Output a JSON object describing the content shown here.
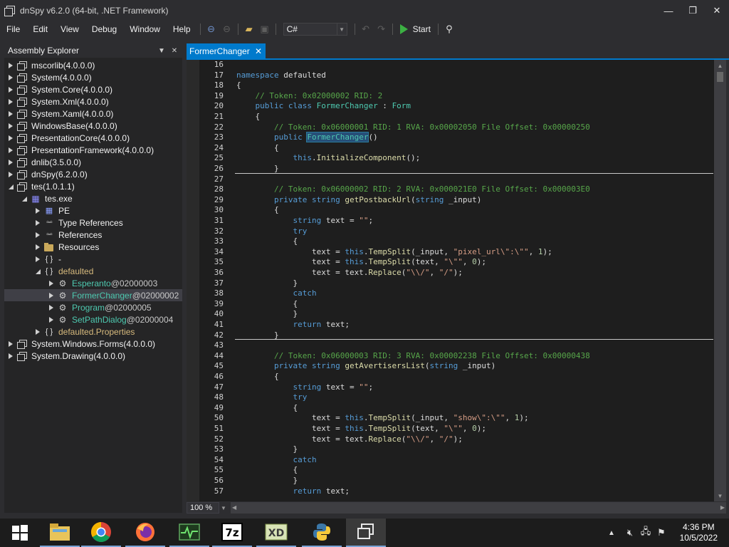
{
  "window": {
    "title": "dnSpy v6.2.0 (64-bit, .NET Framework)",
    "controls": [
      "—",
      "❐",
      "✕"
    ]
  },
  "menu": [
    "File",
    "Edit",
    "View",
    "Debug",
    "Window",
    "Help"
  ],
  "toolbar": {
    "language": "C#",
    "start_label": "Start"
  },
  "explorer": {
    "title": "Assembly Explorer",
    "items": [
      {
        "label": "mscorlib",
        "suffix": " (4.0.0.0)",
        "icon": "assembly",
        "state": "closed",
        "level": 0,
        "color": "plain"
      },
      {
        "label": "System",
        "suffix": " (4.0.0.0)",
        "icon": "assembly",
        "state": "closed",
        "level": 0,
        "color": "plain"
      },
      {
        "label": "System.Core",
        "suffix": " (4.0.0.0)",
        "icon": "assembly",
        "state": "closed",
        "level": 0,
        "color": "plain"
      },
      {
        "label": "System.Xml",
        "suffix": " (4.0.0.0)",
        "icon": "assembly",
        "state": "closed",
        "level": 0,
        "color": "plain"
      },
      {
        "label": "System.Xaml",
        "suffix": " (4.0.0.0)",
        "icon": "assembly",
        "state": "closed",
        "level": 0,
        "color": "plain"
      },
      {
        "label": "WindowsBase",
        "suffix": " (4.0.0.0)",
        "icon": "assembly",
        "state": "closed",
        "level": 0,
        "color": "plain"
      },
      {
        "label": "PresentationCore",
        "suffix": " (4.0.0.0)",
        "icon": "assembly",
        "state": "closed",
        "level": 0,
        "color": "plain"
      },
      {
        "label": "PresentationFramework",
        "suffix": " (4.0.0.0)",
        "icon": "assembly",
        "state": "closed",
        "level": 0,
        "color": "plain"
      },
      {
        "label": "dnlib",
        "suffix": " (3.5.0.0)",
        "icon": "assembly",
        "state": "closed",
        "level": 0,
        "color": "plain"
      },
      {
        "label": "dnSpy",
        "suffix": " (6.2.0.0)",
        "icon": "assembly",
        "state": "closed",
        "level": 0,
        "color": "plain"
      },
      {
        "label": "tes",
        "suffix": " (1.0.1.1)",
        "icon": "assembly",
        "state": "open",
        "level": 0,
        "color": "plain"
      },
      {
        "label": "tes.exe",
        "suffix": "",
        "icon": "module",
        "state": "open",
        "level": 1,
        "color": "plain"
      },
      {
        "label": "PE",
        "suffix": "",
        "icon": "pe",
        "state": "closed",
        "level": 2,
        "color": "plain"
      },
      {
        "label": "Type References",
        "suffix": "",
        "icon": "ref",
        "state": "closed",
        "level": 2,
        "color": "plain"
      },
      {
        "label": "References",
        "suffix": "",
        "icon": "ref",
        "state": "closed",
        "level": 2,
        "color": "plain"
      },
      {
        "label": "Resources",
        "suffix": "",
        "icon": "folder",
        "state": "closed",
        "level": 2,
        "color": "plain"
      },
      {
        "label": "-",
        "suffix": "",
        "icon": "namespace",
        "state": "closed",
        "level": 2,
        "color": "plain"
      },
      {
        "label": "defaulted",
        "suffix": "",
        "icon": "namespace",
        "state": "open",
        "level": 2,
        "color": "yellow"
      },
      {
        "label": "Esperanto",
        "suffix": " @02000003",
        "icon": "class",
        "state": "closed",
        "level": 3,
        "color": "green"
      },
      {
        "label": "FormerChanger",
        "suffix": " @02000002",
        "icon": "class",
        "state": "closed",
        "level": 3,
        "color": "green",
        "selected": true
      },
      {
        "label": "Program",
        "suffix": " @02000005",
        "icon": "class",
        "state": "closed",
        "level": 3,
        "color": "green"
      },
      {
        "label": "SetPathDialog",
        "suffix": " @02000004",
        "icon": "class",
        "state": "closed",
        "level": 3,
        "color": "green"
      },
      {
        "label": "defaulted.Properties",
        "suffix": "",
        "icon": "namespace",
        "state": "closed",
        "level": 2,
        "color": "yellow"
      },
      {
        "label": "System.Windows.Forms",
        "suffix": " (4.0.0.0)",
        "icon": "assembly",
        "state": "closed",
        "level": 0,
        "color": "plain"
      },
      {
        "label": "System.Drawing",
        "suffix": " (4.0.0.0)",
        "icon": "assembly",
        "state": "closed",
        "level": 0,
        "color": "plain"
      }
    ]
  },
  "editor": {
    "tab_label": "FormerChanger",
    "zoom": "100 %",
    "lines": [
      {
        "n": "16",
        "tokens": []
      },
      {
        "n": "17",
        "tokens": [
          [
            "kw",
            "namespace"
          ],
          [
            "nm",
            " defaulted"
          ]
        ]
      },
      {
        "n": "18",
        "tokens": [
          [
            "nm",
            "{"
          ]
        ]
      },
      {
        "n": "19",
        "tokens": [
          [
            "cm",
            "    // Token: 0x02000002 RID: 2"
          ]
        ]
      },
      {
        "n": "20",
        "tokens": [
          [
            "kw",
            "    public class "
          ],
          [
            "ty",
            "FormerChanger"
          ],
          [
            "nm",
            " : "
          ],
          [
            "ty",
            "Form"
          ]
        ]
      },
      {
        "n": "21",
        "tokens": [
          [
            "nm",
            "    {"
          ]
        ]
      },
      {
        "n": "22",
        "tokens": [
          [
            "cm",
            "        // Token: 0x06000001 RID: 1 RVA: 0x00002050 File Offset: 0x00000250"
          ]
        ]
      },
      {
        "n": "23",
        "tokens": [
          [
            "kw",
            "        public "
          ],
          [
            "hl",
            "FormerChanger"
          ],
          [
            "nm",
            "()"
          ]
        ]
      },
      {
        "n": "24",
        "tokens": [
          [
            "nm",
            "        {"
          ]
        ]
      },
      {
        "n": "25",
        "tokens": [
          [
            "kw",
            "            this"
          ],
          [
            "nm",
            "."
          ],
          [
            "mt",
            "InitializeComponent"
          ],
          [
            "nm",
            "();"
          ]
        ]
      },
      {
        "n": "26",
        "tokens": [
          [
            "nm",
            "        }"
          ]
        ]
      },
      {
        "n": "27",
        "tokens": []
      },
      {
        "n": "28",
        "tokens": [
          [
            "cm",
            "        // Token: 0x06000002 RID: 2 RVA: 0x000021E0 File Offset: 0x000003E0"
          ]
        ]
      },
      {
        "n": "29",
        "tokens": [
          [
            "kw",
            "        private string "
          ],
          [
            "mt",
            "getPostbackUrl"
          ],
          [
            "nm",
            "("
          ],
          [
            "kw",
            "string"
          ],
          [
            "nm",
            " _input)"
          ]
        ]
      },
      {
        "n": "30",
        "tokens": [
          [
            "nm",
            "        {"
          ]
        ]
      },
      {
        "n": "31",
        "tokens": [
          [
            "kw",
            "            string"
          ],
          [
            "nm",
            " text = "
          ],
          [
            "st",
            "\"\""
          ],
          [
            "nm",
            ";"
          ]
        ]
      },
      {
        "n": "32",
        "tokens": [
          [
            "kw",
            "            try"
          ]
        ]
      },
      {
        "n": "33",
        "tokens": [
          [
            "nm",
            "            {"
          ]
        ]
      },
      {
        "n": "34",
        "tokens": [
          [
            "nm",
            "                text = "
          ],
          [
            "kw",
            "this"
          ],
          [
            "nm",
            "."
          ],
          [
            "mt",
            "TempSplit"
          ],
          [
            "nm",
            "(_input, "
          ],
          [
            "st",
            "\"pixel_url\\\":\\\"\""
          ],
          [
            "nm",
            ", "
          ],
          [
            "num",
            "1"
          ],
          [
            "nm",
            ");"
          ]
        ]
      },
      {
        "n": "35",
        "tokens": [
          [
            "nm",
            "                text = "
          ],
          [
            "kw",
            "this"
          ],
          [
            "nm",
            "."
          ],
          [
            "mt",
            "TempSplit"
          ],
          [
            "nm",
            "(text, "
          ],
          [
            "st",
            "\"\\\"\""
          ],
          [
            "nm",
            ", "
          ],
          [
            "num",
            "0"
          ],
          [
            "nm",
            ");"
          ]
        ]
      },
      {
        "n": "36",
        "tokens": [
          [
            "nm",
            "                text = text."
          ],
          [
            "mt",
            "Replace"
          ],
          [
            "nm",
            "("
          ],
          [
            "st",
            "\"\\\\/\""
          ],
          [
            "nm",
            ", "
          ],
          [
            "st",
            "\"/\""
          ],
          [
            "nm",
            ");"
          ]
        ]
      },
      {
        "n": "37",
        "tokens": [
          [
            "nm",
            "            }"
          ]
        ]
      },
      {
        "n": "38",
        "tokens": [
          [
            "kw",
            "            catch"
          ]
        ]
      },
      {
        "n": "39",
        "tokens": [
          [
            "nm",
            "            {"
          ]
        ]
      },
      {
        "n": "40",
        "tokens": [
          [
            "nm",
            "            }"
          ]
        ]
      },
      {
        "n": "41",
        "tokens": [
          [
            "kw",
            "            return"
          ],
          [
            "nm",
            " text;"
          ]
        ]
      },
      {
        "n": "42",
        "tokens": [
          [
            "nm",
            "        }"
          ]
        ]
      },
      {
        "n": "43",
        "tokens": []
      },
      {
        "n": "44",
        "tokens": [
          [
            "cm",
            "        // Token: 0x06000003 RID: 3 RVA: 0x00002238 File Offset: 0x00000438"
          ]
        ]
      },
      {
        "n": "45",
        "tokens": [
          [
            "kw",
            "        private string "
          ],
          [
            "mt",
            "getAvertisersList"
          ],
          [
            "nm",
            "("
          ],
          [
            "kw",
            "string"
          ],
          [
            "nm",
            " _input)"
          ]
        ]
      },
      {
        "n": "46",
        "tokens": [
          [
            "nm",
            "        {"
          ]
        ]
      },
      {
        "n": "47",
        "tokens": [
          [
            "kw",
            "            string"
          ],
          [
            "nm",
            " text = "
          ],
          [
            "st",
            "\"\""
          ],
          [
            "nm",
            ";"
          ]
        ]
      },
      {
        "n": "48",
        "tokens": [
          [
            "kw",
            "            try"
          ]
        ]
      },
      {
        "n": "49",
        "tokens": [
          [
            "nm",
            "            {"
          ]
        ]
      },
      {
        "n": "50",
        "tokens": [
          [
            "nm",
            "                text = "
          ],
          [
            "kw",
            "this"
          ],
          [
            "nm",
            "."
          ],
          [
            "mt",
            "TempSplit"
          ],
          [
            "nm",
            "(_input, "
          ],
          [
            "st",
            "\"show\\\":\\\"\""
          ],
          [
            "nm",
            ", "
          ],
          [
            "num",
            "1"
          ],
          [
            "nm",
            ");"
          ]
        ]
      },
      {
        "n": "51",
        "tokens": [
          [
            "nm",
            "                text = "
          ],
          [
            "kw",
            "this"
          ],
          [
            "nm",
            "."
          ],
          [
            "mt",
            "TempSplit"
          ],
          [
            "nm",
            "(text, "
          ],
          [
            "st",
            "\"\\\"\""
          ],
          [
            "nm",
            ", "
          ],
          [
            "num",
            "0"
          ],
          [
            "nm",
            ");"
          ]
        ]
      },
      {
        "n": "52",
        "tokens": [
          [
            "nm",
            "                text = text."
          ],
          [
            "mt",
            "Replace"
          ],
          [
            "nm",
            "("
          ],
          [
            "st",
            "\"\\\\/\""
          ],
          [
            "nm",
            ", "
          ],
          [
            "st",
            "\"/\""
          ],
          [
            "nm",
            ");"
          ]
        ]
      },
      {
        "n": "53",
        "tokens": [
          [
            "nm",
            "            }"
          ]
        ]
      },
      {
        "n": "54",
        "tokens": [
          [
            "kw",
            "            catch"
          ]
        ]
      },
      {
        "n": "55",
        "tokens": [
          [
            "nm",
            "            {"
          ]
        ]
      },
      {
        "n": "56",
        "tokens": [
          [
            "nm",
            "            }"
          ]
        ]
      },
      {
        "n": "57",
        "tokens": [
          [
            "kw",
            "            return"
          ],
          [
            "nm",
            " text;"
          ]
        ]
      }
    ]
  },
  "taskbar": {
    "apps": [
      "windows-start",
      "file-explorer",
      "chrome",
      "firefox",
      "task-manager",
      "7zip",
      "hxd",
      "python",
      "dnspy"
    ],
    "clock_time": "4:36 PM",
    "clock_date": "10/5/2022"
  },
  "colors": {
    "accent": "#007acc",
    "keyword": "#569cd6",
    "type": "#4ec9b0",
    "method": "#dcdcaa",
    "string": "#d69d85",
    "comment": "#57a64a"
  }
}
